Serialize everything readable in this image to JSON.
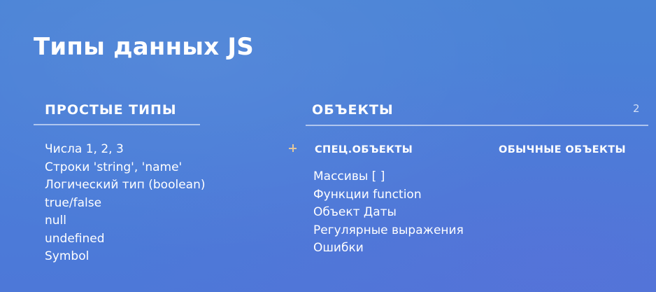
{
  "slide": {
    "title": "Типы данных JS",
    "page_number": "2"
  },
  "simple_types": {
    "header": "ПРОСТЫЕ ТИПЫ",
    "items": [
      "Числа   1, 2, 3",
      "Строки 'string', 'name'",
      "Логический тип (boolean)",
      "true/false",
      "null",
      "undefined",
      "Symbol"
    ]
  },
  "objects": {
    "header": "ОБЪЕКТЫ",
    "special": {
      "header": "СПЕЦ.ОБЪЕКТЫ",
      "items": [
        "Массивы [ ]",
        "Функции function",
        "Объект Даты",
        "Регулярные выражения",
        "Ошибки"
      ]
    },
    "regular": {
      "header": "ОБЫЧНЫЕ ОБЪЕКТЫ"
    }
  },
  "icons": {
    "cursor": "plus-cursor-icon"
  },
  "colors": {
    "background": "#4a7fd7",
    "text": "#ffffff",
    "cursor": "#e3c79b"
  }
}
